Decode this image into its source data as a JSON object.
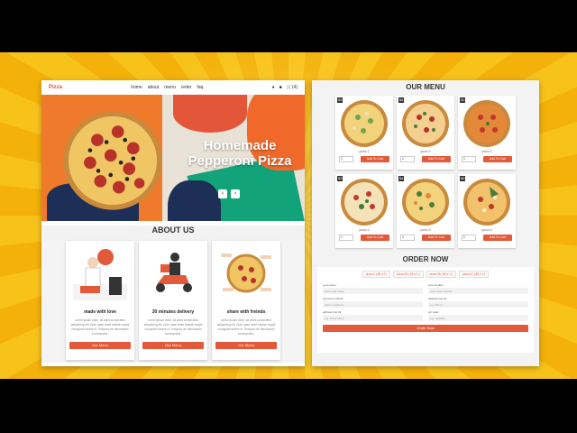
{
  "nav": {
    "logo": "Pizza",
    "links": [
      "home",
      "about",
      "menu",
      "order",
      "faq"
    ],
    "cart_count": "(4)"
  },
  "hero": {
    "title": "Homemade Pepperoni Pizza",
    "prev": "‹",
    "next": "›"
  },
  "about": {
    "title": "ABOUT US",
    "cards": [
      {
        "title": "made with love",
        "text": "Lorem ipsum dolor, sit amet consectetur adipisicing elit. Illum quae amet beatae magni numquam facere ut. Tempora vel laboriosam consequatur.",
        "button": "Our Menu"
      },
      {
        "title": "30 minutes delivery",
        "text": "Lorem ipsum dolor, sit amet consectetur adipisicing elit. Illum quae amet beatae magni numquam facere ut. Tempora vel laboriosam consequatur.",
        "button": "Our Menu"
      },
      {
        "title": "share with freinds",
        "text": "Lorem ipsum dolor, sit amet consectetur adipisicing elit. Illum quae amet beatae magni numquam facere ut. Tempora vel laboriosam consequatur.",
        "button": "Our Menu"
      }
    ]
  },
  "menu": {
    "title": "OUR MENU",
    "items": [
      {
        "price": "$3",
        "name": "pizza 1",
        "qty": "1",
        "button": "Add To Cart"
      },
      {
        "price": "$4",
        "name": "pizza 2",
        "qty": "1",
        "button": "Add To Cart"
      },
      {
        "price": "$2",
        "name": "pizza 3",
        "qty": "1",
        "button": "Add To Cart"
      },
      {
        "price": "$3",
        "name": "pizza 4",
        "qty": "1",
        "button": "Add To Cart"
      },
      {
        "price": "$4",
        "name": "pizza 5",
        "qty": "1",
        "button": "Add To Cart"
      },
      {
        "price": "$5",
        "name": "pizza 6",
        "qty": "1",
        "button": "Add To Cart"
      }
    ]
  },
  "order": {
    "title": "ORDER NOW",
    "chips": [
      "pizza 1 ( $3 x 2 )",
      "pizza 03 ( $2 x 1 )",
      "pizza 06 ( $4 x 1 )",
      "pizza 07 ( $2 x 1 )"
    ],
    "fields": [
      {
        "label": "your name :",
        "placeholder": "enter your name"
      },
      {
        "label": "your number :",
        "placeholder": "enter your number"
      },
      {
        "label": "payment method :",
        "placeholder": "cash on delivery"
      },
      {
        "label": "address line 01 :",
        "placeholder": "e.g. flat no."
      },
      {
        "label": "address line 02 :",
        "placeholder": "e.g. street name"
      },
      {
        "label": "pin code :",
        "placeholder": "e.g. 123456"
      }
    ],
    "button": "Order Now"
  },
  "colors": {
    "accent": "#e25a3a",
    "background": "#f7c21a"
  }
}
